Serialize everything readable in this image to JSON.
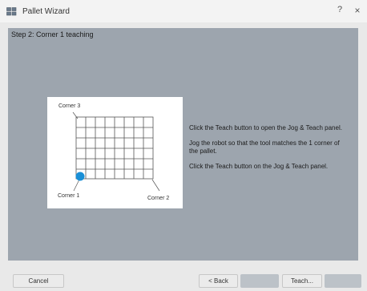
{
  "window": {
    "title": "Pallet Wizard",
    "help_label": "?",
    "close_label": "×"
  },
  "step": {
    "title": "Step 2: Corner 1 teaching"
  },
  "diagram": {
    "corner3_label": "Corner 3",
    "corner1_label": "Corner 1",
    "corner2_label": "Corner 2",
    "grid_columns": 8,
    "grid_rows": 6,
    "highlight_corner": "Corner 1",
    "highlight_color": "#1a8fd6"
  },
  "instructions": {
    "line1": "Click the Teach button to open the Jog & Teach panel.",
    "line2": "Jog the robot so that the tool matches the 1 corner of the pallet.",
    "line3": "Click the Teach button on the Jog & Teach panel."
  },
  "buttons": {
    "cancel": "Cancel",
    "back": "< Back",
    "next": "",
    "teach": "Teach...",
    "finish": ""
  }
}
